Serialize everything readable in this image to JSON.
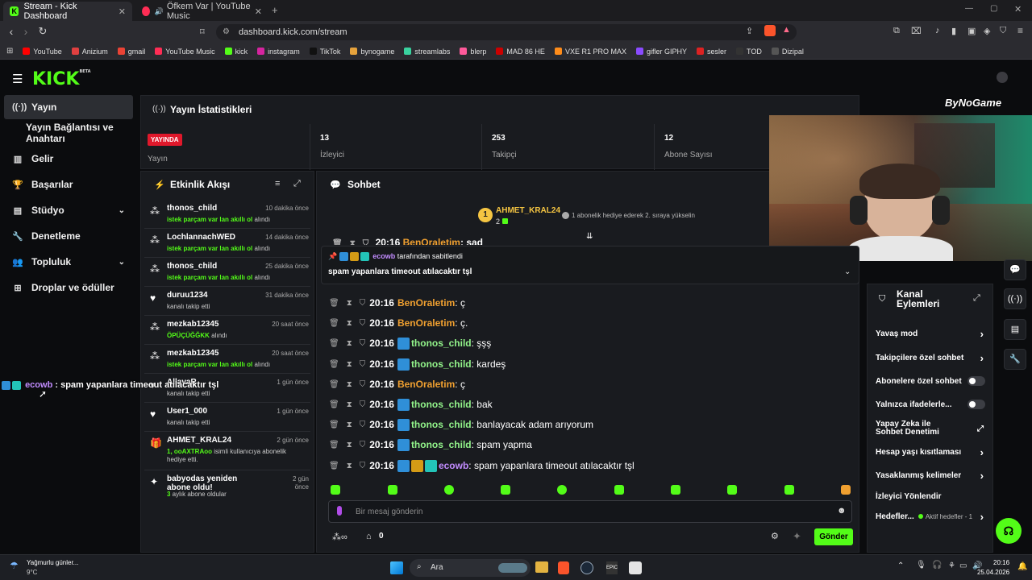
{
  "browser": {
    "tabs": [
      {
        "label": "Stream - Kick Dashboard",
        "active": true
      },
      {
        "label": "Öfkem Var | YouTube Music",
        "active": false
      }
    ],
    "url": "dashboard.kick.com/stream",
    "bookmarks": [
      "YouTube",
      "Anizium",
      "gmail",
      "YouTube Music",
      "kick",
      "instagram",
      "TikTok",
      "bynogame",
      "streamlabs",
      "blerp",
      "MAD 86 HE",
      "VXE R1 PRO MAX",
      "gifler GIPHY",
      "sesler",
      "TOD",
      "Dizipal"
    ]
  },
  "sidebar": {
    "items": [
      {
        "label": "Yayın",
        "icon": "broadcast-icon",
        "active": true
      },
      {
        "label": "Yayın Bağlantısı ve Anahtarı",
        "icon": "",
        "active": false
      },
      {
        "label": "Gelir",
        "icon": "chart-icon",
        "active": false
      },
      {
        "label": "Başarılar",
        "icon": "trophy-icon",
        "active": false
      },
      {
        "label": "Stüdyo",
        "icon": "studio-icon",
        "active": false,
        "chevron": true
      },
      {
        "label": "Denetleme",
        "icon": "wrench-icon",
        "active": false
      },
      {
        "label": "Topluluk",
        "icon": "community-icon",
        "active": false,
        "chevron": true
      },
      {
        "label": "Droplar ve ödüller",
        "icon": "drops-icon",
        "active": false
      }
    ]
  },
  "stats": {
    "title": "Yayın İstatistikleri",
    "live_badge": "YAYINDA",
    "live_label": "Yayın",
    "viewers_value": "13",
    "viewers_label": "İzleyici",
    "followers_value": "253",
    "followers_label": "Takipçi",
    "subs_value": "12",
    "subs_label": "Abone Sayısı"
  },
  "activity": {
    "title": "Etkinlik Akışı",
    "events": [
      {
        "name": "thonos_child",
        "sub_highlight": "istek parçam var lan akıllı ol",
        "sub_rest": " alındı",
        "time": "10 dakika önce",
        "icon": "points-icon"
      },
      {
        "name": "LochlannachWED",
        "sub_highlight": "istek parçam var lan akıllı ol",
        "sub_rest": " alındı",
        "time": "14 dakika önce",
        "icon": "points-icon"
      },
      {
        "name": "thonos_child",
        "sub_highlight": "istek parçam var lan akıllı ol",
        "sub_rest": " alındı",
        "time": "25 dakika önce",
        "icon": "points-icon"
      },
      {
        "name": "duruu1234",
        "sub_highlight": "",
        "sub_rest": "kanalı takip etti",
        "time": "31 dakika önce",
        "icon": "heart-icon"
      },
      {
        "name": "mezkab12345",
        "sub_highlight": "ÖPÜÇÜĞĞKK",
        "sub_rest": " alındı",
        "time": "20 saat önce",
        "icon": "points-icon"
      },
      {
        "name": "mezkab12345",
        "sub_highlight": "istek parçam var lan akıllı ol",
        "sub_rest": " alındı",
        "time": "20 saat önce",
        "icon": "points-icon"
      },
      {
        "name": "AllavaR",
        "sub_highlight": "",
        "sub_rest": "kanalı takip etti",
        "time": "1 gün önce",
        "icon": "heart-icon"
      },
      {
        "name": "User1_000",
        "sub_highlight": "",
        "sub_rest": "kanalı takip etti",
        "time": "1 gün önce",
        "icon": "heart-icon"
      },
      {
        "name": "AHMET_KRAL24",
        "sub_highlight": "1, ooAXTRAoo",
        "sub_rest": " isimli kullanıcıya abonelik hediye etti.",
        "time": "2 gün önce",
        "icon": "gift-icon"
      },
      {
        "name": "babyodas yeniden abone oldu!",
        "sub_highlight": "3",
        "sub_rest": " aylık abone oldular",
        "time": "2 gün önce",
        "icon": "sparkle-icon"
      }
    ]
  },
  "overlay_chat": {
    "user": "ecowb",
    "text": ": spam yapanlara timeout atılacaktır tşl"
  },
  "chat": {
    "title": "Sohbet",
    "top_gifter_name": "AHMET_KRAL24",
    "top_gifter_count": "2",
    "top_gifter_note": "1 abonelik hediye ederek 2. sıraya yükselin",
    "pinned_by_user": "ecowb",
    "pinned_by_text": "tarafından sabitlendi",
    "pinned_message": "spam yapanlara timeout atılacaktır tşl",
    "partial_row": {
      "time": "20:16",
      "user": "BenOraletim",
      "text": "sad"
    },
    "messages": [
      {
        "time": "20:16",
        "user": "BenOraletim",
        "color": "#f0a030",
        "badges": [],
        "text": "ç"
      },
      {
        "time": "20:16",
        "user": "BenOraletim",
        "color": "#f0a030",
        "badges": [],
        "text": "ç."
      },
      {
        "time": "20:16",
        "user": "thonos_child",
        "color": "#93f58b",
        "badges": [
          "blue"
        ],
        "text": "şşş"
      },
      {
        "time": "20:16",
        "user": "thonos_child",
        "color": "#93f58b",
        "badges": [
          "blue"
        ],
        "text": "kardeş"
      },
      {
        "time": "20:16",
        "user": "BenOraletim",
        "color": "#f0a030",
        "badges": [],
        "text": "ç"
      },
      {
        "time": "20:16",
        "user": "thonos_child",
        "color": "#93f58b",
        "badges": [
          "blue"
        ],
        "text": "bak"
      },
      {
        "time": "20:16",
        "user": "thonos_child",
        "color": "#93f58b",
        "badges": [
          "blue"
        ],
        "text": "banlayacak adam arıyorum"
      },
      {
        "time": "20:16",
        "user": "thonos_child",
        "color": "#93f58b",
        "badges": [
          "blue"
        ],
        "text": "spam yapma"
      },
      {
        "time": "20:16",
        "user": "ecowb",
        "color": "#c28cff",
        "badges": [
          "blue",
          "gold",
          "teal"
        ],
        "text": "spam yapanlara timeout atılacaktır tşl"
      }
    ],
    "input_placeholder": "Bir mesaj gönderin",
    "points_value": "0",
    "send_label": "Gönder"
  },
  "channel_actions": {
    "title": "Kanal Eylemleri",
    "items": [
      {
        "label": "Yavaş mod",
        "control": "chevron"
      },
      {
        "label": "Takipçilere özel sohbet",
        "control": "chevron"
      },
      {
        "label": "Abonelere özel sohbet",
        "control": "toggle"
      },
      {
        "label": "Yalnızca ifadelerle...",
        "control": "toggle"
      },
      {
        "label": "Yapay Zeka ile Sohbet Denetimi",
        "control": "external"
      },
      {
        "label": "Hesap yaşı kısıtlaması",
        "control": "chevron"
      },
      {
        "label": "Yasaklanmış kelimeler",
        "control": "chevron"
      },
      {
        "label": "İzleyici Yönlendir",
        "control": "none"
      },
      {
        "label": "Hedefler...",
        "control": "chevron",
        "extra": "Aktif hedefler - 1"
      }
    ]
  },
  "webcam_logo": "ByNoGame",
  "taskbar": {
    "weather_title": "Yağmurlu günler...",
    "weather_temp": "9°C",
    "search_label": "Ara",
    "time": "20:16",
    "date": "25.04.2026"
  },
  "colors": {
    "kick_green": "#53fc18",
    "live_red": "#e0182b"
  }
}
